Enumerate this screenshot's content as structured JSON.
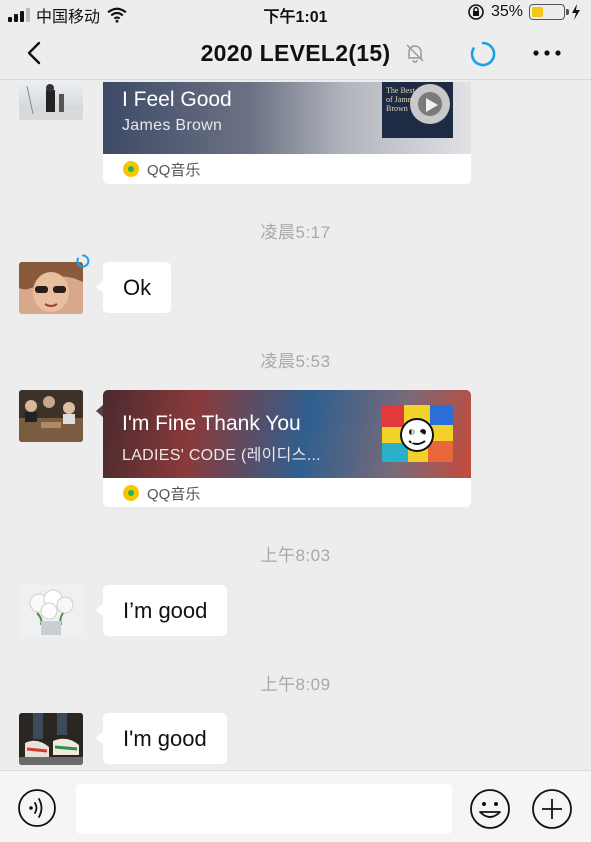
{
  "status_bar": {
    "carrier": "中国移动",
    "time": "下午1:01",
    "battery_percent": "35%",
    "battery_level": 0.35,
    "battery_color": "#f5c518"
  },
  "nav": {
    "title": "2020 LEVEL2(15)",
    "icons": [
      "back-arrow-icon",
      "mute-bell-icon",
      "loading-spinner-icon",
      "more-icon"
    ],
    "accent": "#1aa0e6"
  },
  "messages": [
    {
      "type": "music",
      "title": "I Feel Good",
      "artist": "James Brown",
      "source": "QQ音乐",
      "cover_text": "The Best of James Brown"
    },
    {
      "type": "timestamp",
      "text": "凌晨5:17"
    },
    {
      "type": "text",
      "text": "Ok"
    },
    {
      "type": "timestamp",
      "text": "凌晨5:53"
    },
    {
      "type": "music",
      "title": "I'm Fine Thank You",
      "artist": "LADIES' CODE (레이디스...",
      "source": "QQ音乐"
    },
    {
      "type": "timestamp",
      "text": "上午8:03"
    },
    {
      "type": "text",
      "text": "I’m good"
    },
    {
      "type": "timestamp",
      "text": "上午8:09"
    },
    {
      "type": "text",
      "text": "I'm good"
    }
  ],
  "input": {
    "value": "",
    "icons": [
      "voice-icon",
      "emoji-icon",
      "plus-icon"
    ]
  }
}
